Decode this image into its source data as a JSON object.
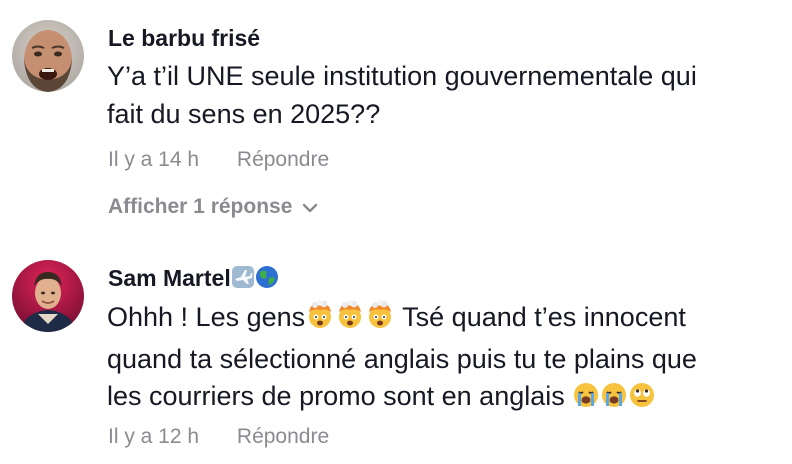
{
  "comments": [
    {
      "author": "Le barbu frisé",
      "text_lines": [
        "Y’a t’il UNE seule institution gouvernementale qui",
        "fait du sens en 2025??"
      ],
      "time": "Il y a 14 h",
      "reply_label": "Répondre",
      "view_replies": "Afficher 1 réponse"
    },
    {
      "author": "Sam Martel",
      "author_emojis": [
        "airplane-emoji",
        "globe-emoji"
      ],
      "text": {
        "l1a": "Ohhh ! Les gens",
        "l1b": " Tsé quand t’es innocent",
        "l2": "quand ta sélectionné anglais puis tu te plains que",
        "l3": "les courriers de promo sont en anglais "
      },
      "time": "Il y a 12 h",
      "reply_label": "Répondre"
    }
  ],
  "icons": {
    "view_replies": "chevron-down-icon",
    "mind_blown": "exploding-head-emoji",
    "crying": "loudly-crying-emoji",
    "eye_roll": "eye-roll-emoji"
  },
  "colors": {
    "text": "#161823",
    "secondary": "#8a8b91"
  }
}
